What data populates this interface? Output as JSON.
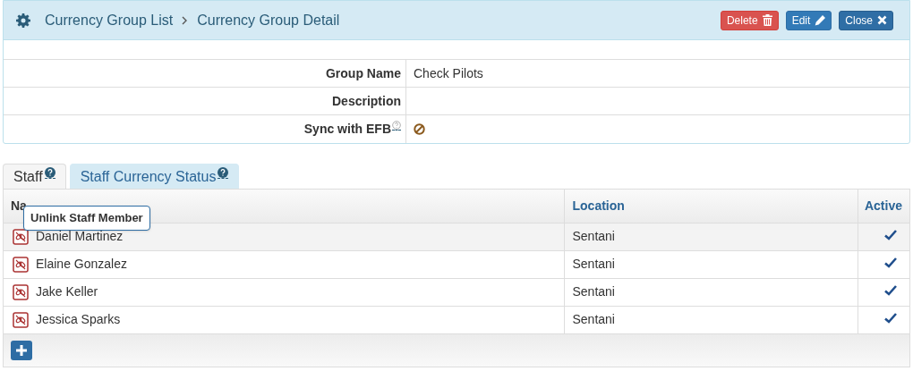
{
  "breadcrumb": [
    "Currency Group List",
    "Currency Group Detail"
  ],
  "buttons": [
    {
      "kind": "delete",
      "label": "Delete"
    },
    {
      "kind": "edit",
      "label": "Edit"
    },
    {
      "kind": "close",
      "label": "Close"
    }
  ],
  "fields": [
    {
      "label": "Group Name",
      "value": "Check Pilots"
    },
    {
      "label": "Description"
    },
    {
      "label": "Sync with EFB",
      "help": true,
      "kind": "flag",
      "on": false
    }
  ],
  "tabs": [
    {
      "label": "Staff",
      "selected": true
    },
    {
      "label": "Staff Currency Status",
      "selected": false
    }
  ],
  "table": {
    "columns": [
      "Na",
      "Location",
      "Active"
    ],
    "rows": [
      {
        "name": "Daniel Martinez",
        "location": "Sentani",
        "active": true,
        "hovered": true
      },
      {
        "name": "Elaine Gonzalez",
        "location": "Sentani",
        "active": true,
        "hovered": false
      },
      {
        "name": "Jake Keller",
        "location": "Sentani",
        "active": true,
        "hovered": false
      },
      {
        "name": "Jessica Sparks",
        "location": "Sentani",
        "active": true,
        "hovered": false
      }
    ]
  },
  "tooltip": "Unlink Staff Member"
}
